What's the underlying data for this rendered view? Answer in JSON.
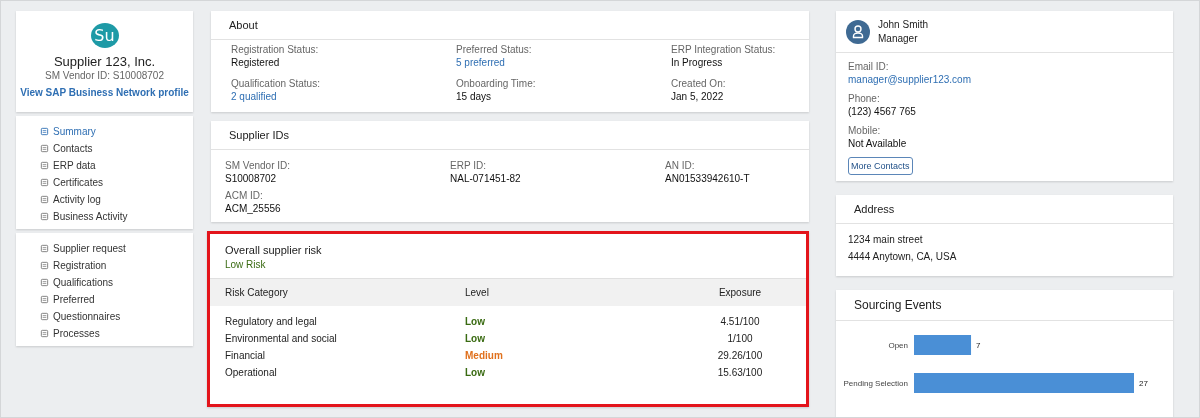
{
  "supplier": {
    "avatar": "Su",
    "name": "Supplier 123, Inc.",
    "vendor_id": "SM Vendor ID: S10008702",
    "profile_link": "View SAP Business Network profile"
  },
  "nav_groups": [
    [
      {
        "label": "Summary",
        "selected": true
      },
      {
        "label": "Contacts",
        "selected": false
      },
      {
        "label": "ERP data",
        "selected": false
      },
      {
        "label": "Certificates",
        "selected": false
      },
      {
        "label": "Activity log",
        "selected": false
      },
      {
        "label": "Business Activity",
        "selected": false
      }
    ],
    [
      {
        "label": "Supplier request",
        "selected": false
      },
      {
        "label": "Registration",
        "selected": false
      },
      {
        "label": "Qualifications",
        "selected": false
      },
      {
        "label": "Preferred",
        "selected": false
      },
      {
        "label": "Questionnaires",
        "selected": false
      },
      {
        "label": "Processes",
        "selected": false
      }
    ]
  ],
  "about": {
    "title": "About",
    "fields": [
      {
        "label": "Registration Status:",
        "value": "Registered",
        "kind": "text"
      },
      {
        "label": "Preferred Status:",
        "value": "5 preferred",
        "kind": "link"
      },
      {
        "label": "ERP Integration Status:",
        "value": "In Progress",
        "kind": "text"
      },
      {
        "label": "Qualification Status:",
        "value": "2 qualified",
        "kind": "link"
      },
      {
        "label": "Onboarding Time:",
        "value": "15 days",
        "kind": "text"
      },
      {
        "label": "Created On:",
        "value": "Jan 5, 2022",
        "kind": "text"
      }
    ]
  },
  "supplier_ids": {
    "title": "Supplier IDs",
    "fields": [
      {
        "label": "SM Vendor ID:",
        "value": "S10008702"
      },
      {
        "label": "ERP ID:",
        "value": "NAL-071451-82"
      },
      {
        "label": "AN ID:",
        "value": "AN01533942610-T"
      },
      {
        "label": "ACM ID:",
        "value": "ACM_25556"
      }
    ]
  },
  "risk": {
    "title": "Overall supplier risk",
    "summary": "Low Risk",
    "highlighted": true,
    "columns": [
      "Risk Category",
      "Level",
      "Exposure"
    ],
    "rows": [
      {
        "category": "Regulatory and legal",
        "level": "Low",
        "color": "#3a6b12",
        "exposure": "4.51/100"
      },
      {
        "category": "Environmental and social",
        "level": "Low",
        "color": "#3a6b12",
        "exposure": "1/100"
      },
      {
        "category": "Financial",
        "level": "Medium",
        "color": "#e0701c",
        "exposure": "29.26/100"
      },
      {
        "category": "Operational",
        "level": "Low",
        "color": "#3a6b12",
        "exposure": "15.63/100"
      }
    ]
  },
  "contact": {
    "name": "John Smith",
    "role": "Manager",
    "fields": [
      {
        "label": "Email ID:",
        "value": "manager@supplier123.com",
        "kind": "link"
      },
      {
        "label": "Phone:",
        "value": "(123) 4567 765",
        "kind": "text"
      },
      {
        "label": "Mobile:",
        "value": "Not Available",
        "kind": "text"
      }
    ],
    "button": "More Contacts"
  },
  "address": {
    "title": "Address",
    "lines": [
      "1234 main street",
      "4444 Anytown, CA, USA"
    ]
  },
  "sourcing": {
    "title": "Sourcing Events",
    "chart_data": {
      "type": "bar",
      "orientation": "horizontal",
      "categories": [
        "Open",
        "Pending Selection"
      ],
      "series": [
        {
          "color": "#4a8fd6",
          "values": [
            7,
            27
          ]
        }
      ],
      "data_labels": true
    }
  }
}
